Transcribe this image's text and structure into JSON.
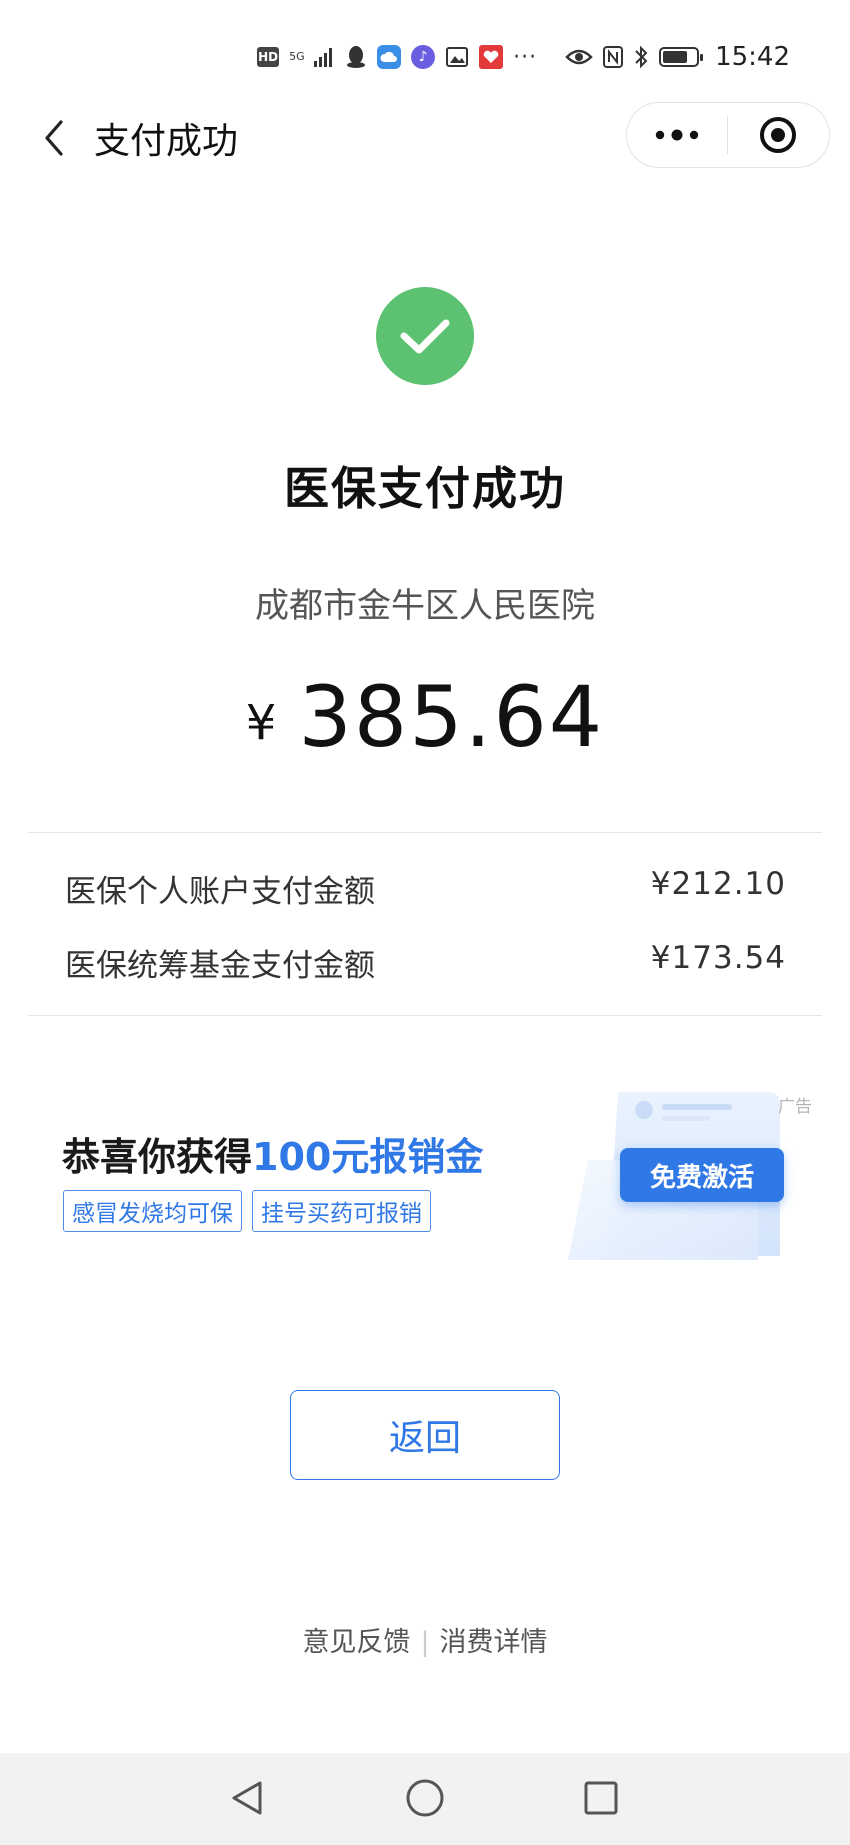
{
  "status_bar": {
    "hd_label": "HD",
    "network_label": "5G",
    "time": "15:42",
    "battery_level": 0.75,
    "icons": [
      "hd-icon",
      "5g-icon",
      "signal-icon",
      "qq-icon",
      "cloud-icon",
      "music-icon",
      "gallery-icon",
      "health-icon",
      "more-notifications-icon",
      "eye-icon",
      "nfc-icon",
      "bluetooth-icon",
      "battery-icon"
    ],
    "more_label": "···"
  },
  "nav": {
    "title": "支付成功",
    "back_icon": "chevron-left-icon",
    "more_icon": "more-dots-icon",
    "close_icon": "target-icon"
  },
  "payment": {
    "title": "医保支付成功",
    "hospital": "成都市金牛区人民医院",
    "currency_symbol": "¥",
    "amount": "385.64",
    "details": [
      {
        "label": "医保个人账户支付金额",
        "value": "¥212.10"
      },
      {
        "label": "医保统筹基金支付金额",
        "value": "¥173.54"
      }
    ]
  },
  "ad": {
    "headline_prefix": "恭喜你获得",
    "headline_highlight": "100元报销金",
    "tags": [
      "感冒发烧均可保",
      "挂号买药可报销"
    ],
    "cta": "免费激活",
    "label": "广告"
  },
  "actions": {
    "return_label": "返回"
  },
  "footer": {
    "feedback": "意见反馈",
    "separator": "|",
    "details": "消费详情"
  },
  "colors": {
    "success_green": "#5cc170",
    "accent_blue": "#2f78e6"
  }
}
